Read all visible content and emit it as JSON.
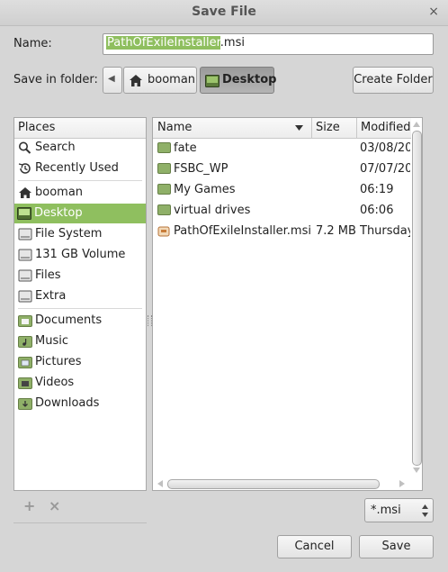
{
  "window": {
    "title": "Save File",
    "close_glyph": "×"
  },
  "name_field": {
    "label": "Name:",
    "selected_part": "PathOfExileInstaller",
    "rest_part": ".msi"
  },
  "folder_bar": {
    "label": "Save in folder:",
    "back_glyph": "◀",
    "crumbs": [
      "booman",
      "Desktop"
    ],
    "create_folder": "Create Folder"
  },
  "places": {
    "header": "Places",
    "items": [
      "Search",
      "Recently Used",
      "booman",
      "Desktop",
      "File System",
      "131 GB Volume",
      "Files",
      "Extra",
      "Documents",
      "Music",
      "Pictures",
      "Videos",
      "Downloads"
    ],
    "add_glyph": "+",
    "remove_glyph": "×"
  },
  "files": {
    "columns": {
      "name": "Name",
      "size": "Size",
      "modified": "Modified"
    },
    "rows": [
      {
        "name": "fate",
        "size": "",
        "modified": "03/08/20",
        "icon": "folder-icon"
      },
      {
        "name": "FSBC_WP",
        "size": "",
        "modified": "07/07/20",
        "icon": "folder-icon"
      },
      {
        "name": "My Games",
        "size": "",
        "modified": "06:19",
        "icon": "folder-icon"
      },
      {
        "name": "virtual drives",
        "size": "",
        "modified": "06:06",
        "icon": "folder-icon"
      },
      {
        "name": "PathOfExileInstaller.msi",
        "size": "7.2 MB",
        "modified": "Thursday",
        "icon": "package-icon"
      }
    ]
  },
  "filter": {
    "value": "*.msi"
  },
  "actions": {
    "cancel": "Cancel",
    "save": "Save"
  },
  "colors": {
    "selection": "#8fbf5f",
    "folder": "#8fb068"
  }
}
